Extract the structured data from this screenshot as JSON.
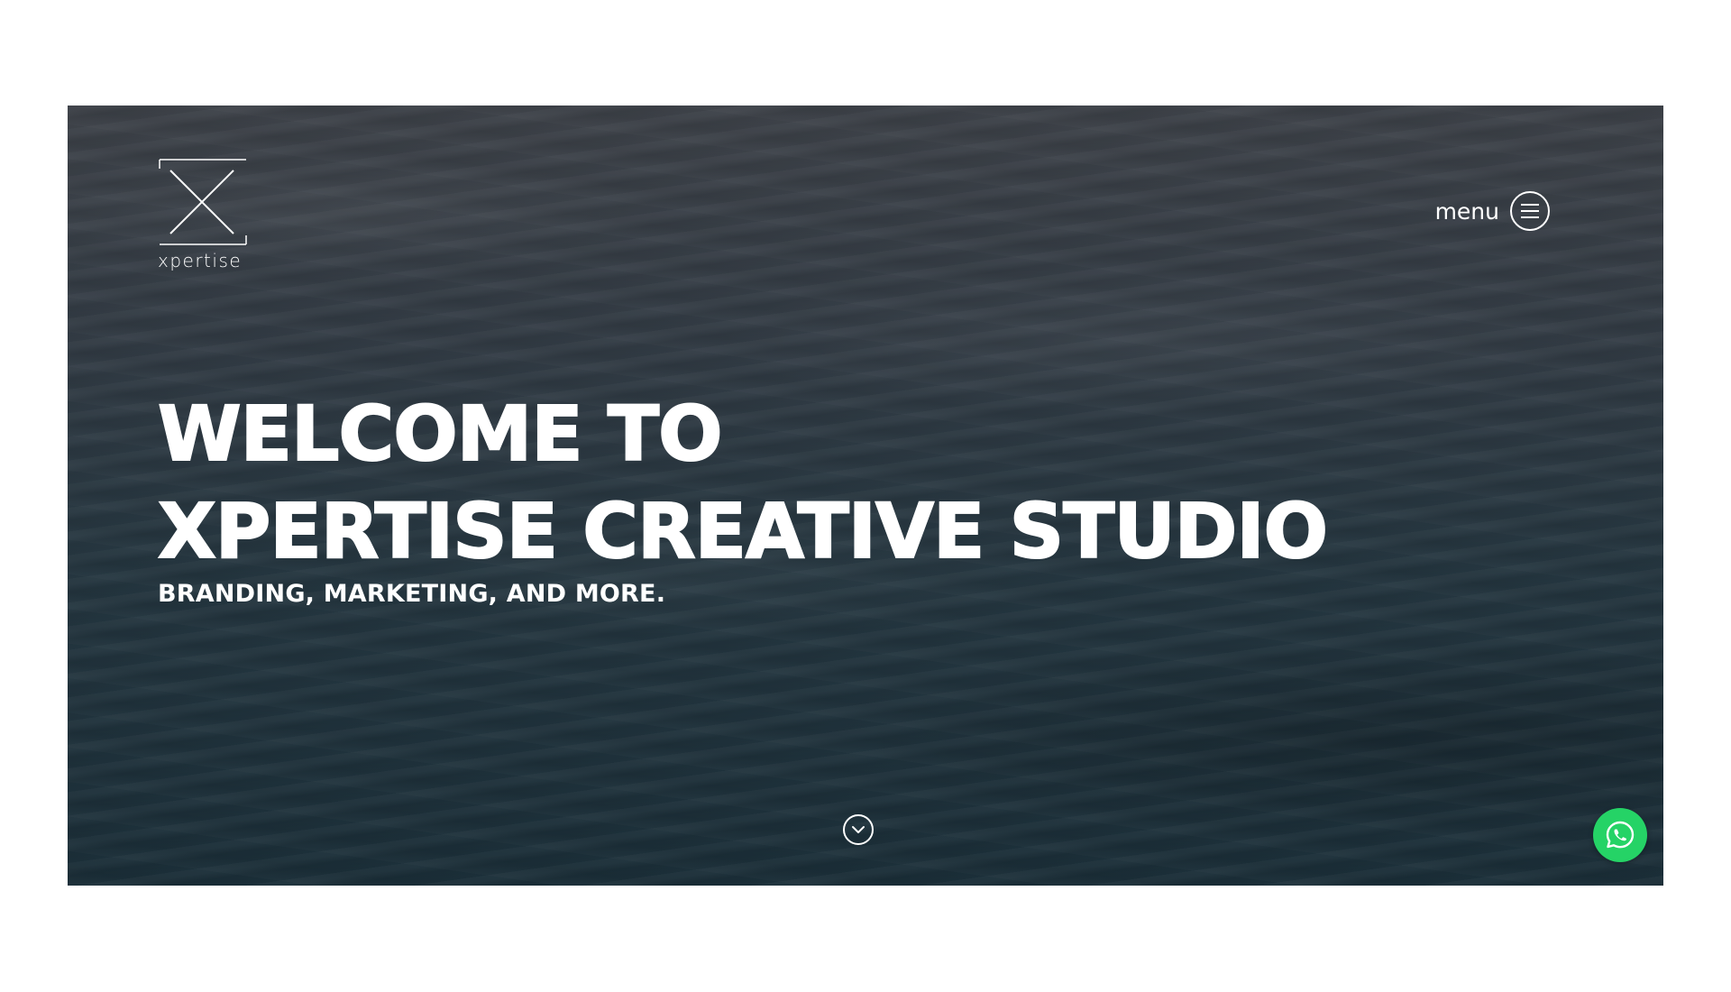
{
  "brand": {
    "name": "xpertise",
    "logo_icon": "x-logo-icon"
  },
  "header": {
    "menu_label": "menu",
    "menu_icon": "hamburger-circle-icon"
  },
  "hero": {
    "headline_line1": "WELCOME TO",
    "headline_line2": "XPERTISE CREATIVE STUDIO",
    "subheadline": "BRANDING, MARKETING, AND MORE.",
    "background": "ocean-waves-image",
    "scroll_icon": "chevron-down-circle-icon"
  },
  "floating": {
    "whatsapp_icon": "whatsapp-icon",
    "whatsapp_color": "#25d366"
  },
  "colors": {
    "page_background": "#ffffff",
    "text": "#ffffff",
    "hero_tint": "#2b3f4a"
  }
}
